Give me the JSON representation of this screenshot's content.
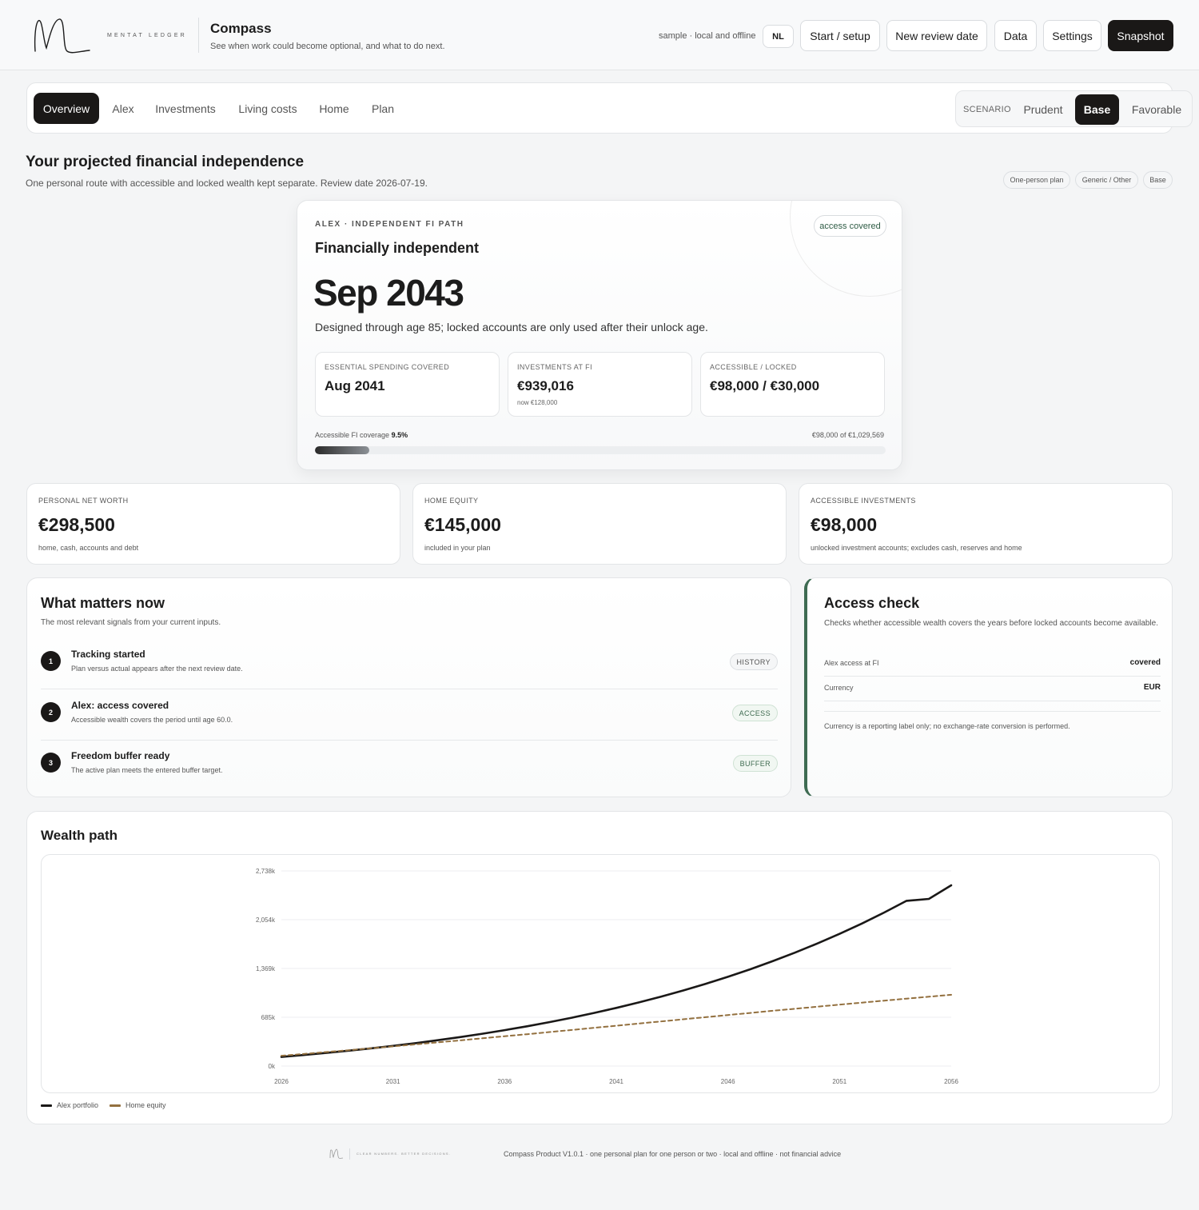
{
  "brand": {
    "wordmark": "MENTAT LEDGER",
    "tagline": "CLEAR NUMBERS. BETTER DECISIONS."
  },
  "header": {
    "title": "Compass",
    "subtitle": "See when work could become optional, and what to do next.",
    "sample_note": "sample · local and offline",
    "language": "NL",
    "buttons": {
      "setup": "Start / setup",
      "review": "New review date",
      "data": "Data",
      "settings": "Settings",
      "snapshot": "Snapshot"
    }
  },
  "nav": {
    "tabs": [
      "Overview",
      "Alex",
      "Investments",
      "Living costs",
      "Home",
      "Plan"
    ],
    "active_tab": "Overview",
    "scenario_label": "SCENARIO",
    "scenarios": [
      "Prudent",
      "Base",
      "Favorable"
    ],
    "active_scenario": "Base"
  },
  "page": {
    "heading": "Your projected financial independence",
    "subheading": "One personal route with accessible and locked wealth kept separate. Review date 2026-07-19.",
    "chips": [
      "One-person plan",
      "Generic / Other",
      "Base"
    ]
  },
  "hero": {
    "eyebrow": "ALEX · INDEPENDENT FI PATH",
    "status": "Financially independent",
    "date": "Sep 2043",
    "design_note": "Designed through age 85; locked accounts are only used after their unlock age.",
    "badge": "access covered",
    "stats": [
      {
        "label": "ESSENTIAL SPENDING COVERED",
        "value": "Aug 2041",
        "note": ""
      },
      {
        "label": "INVESTMENTS AT FI",
        "value": "€939,016",
        "note": "now €128,000"
      },
      {
        "label": "ACCESSIBLE / LOCKED",
        "value": "€98,000 / €30,000",
        "note": ""
      }
    ],
    "coverage_label": "Accessible FI coverage",
    "coverage_value": "9.5%",
    "coverage_fraction": 0.095,
    "coverage_detail": "€98,000 of €1,029,569"
  },
  "metrics": [
    {
      "label": "PERSONAL NET WORTH",
      "value": "€298,500",
      "note": "home, cash, accounts and debt"
    },
    {
      "label": "HOME EQUITY",
      "value": "€145,000",
      "note": "included in your plan"
    },
    {
      "label": "ACCESSIBLE INVESTMENTS",
      "value": "€98,000",
      "note": "unlocked investment accounts; excludes cash, reserves and home"
    }
  ],
  "what_matters": {
    "title": "What matters now",
    "subtitle": "The most relevant signals from your current inputs.",
    "items": [
      {
        "num": "1",
        "title": "Tracking started",
        "desc": "Plan versus actual appears after the next review date.",
        "tag": "HISTORY"
      },
      {
        "num": "2",
        "title": "Alex: access covered",
        "desc": "Accessible wealth covers the period until age 60.0.",
        "tag": "ACCESS"
      },
      {
        "num": "3",
        "title": "Freedom buffer ready",
        "desc": "The active plan meets the entered buffer target.",
        "tag": "BUFFER"
      }
    ]
  },
  "access_check": {
    "title": "Access check",
    "subtitle": "Checks whether accessible wealth covers the years before locked accounts become available.",
    "rows": [
      {
        "key": "Alex access at FI",
        "value": "covered"
      },
      {
        "key": "Currency",
        "value": "EUR"
      }
    ],
    "note": "Currency is a reporting label only; no exchange-rate conversion is performed."
  },
  "wealth_path": {
    "title": "Wealth path"
  },
  "chart_data": {
    "type": "line",
    "title": "Wealth path",
    "x": [
      2026,
      2027,
      2028,
      2029,
      2030,
      2031,
      2032,
      2033,
      2034,
      2035,
      2036,
      2037,
      2038,
      2039,
      2040,
      2041,
      2042,
      2043,
      2044,
      2045,
      2046,
      2047,
      2048,
      2049,
      2050,
      2051,
      2052,
      2053,
      2054,
      2055,
      2056
    ],
    "x_ticks": [
      "2026",
      "2031",
      "2036",
      "2041",
      "2046",
      "2051",
      "2056"
    ],
    "y_ticks": [
      "0k",
      "685k",
      "1,369k",
      "2,054k",
      "2,738k"
    ],
    "ylim": [
      0,
      2738
    ],
    "series": [
      {
        "name": "Alex portfolio",
        "color": "#1a1817",
        "dash": false,
        "values": [
          128,
          155,
          184,
          215,
          248,
          283,
          321,
          362,
          406,
          453,
          504,
          558,
          616,
          678,
          745,
          816,
          892,
          973,
          1060,
          1153,
          1252,
          1358,
          1471,
          1591,
          1719,
          1855,
          2000,
          2154,
          2318,
          2345,
          2536
        ]
      },
      {
        "name": "Home equity",
        "color": "#93703f",
        "dash": true,
        "values": [
          145,
          170,
          196,
          222,
          249,
          276,
          304,
          332,
          360,
          389,
          418,
          447,
          477,
          506,
          536,
          566,
          596,
          626,
          656,
          686,
          716,
          745,
          775,
          804,
          833,
          862,
          890,
          918,
          946,
          973,
          1000
        ]
      }
    ]
  },
  "footer": {
    "text": "Compass Product V1.0.1 · one personal plan for one person or two · local and offline · not financial advice"
  }
}
